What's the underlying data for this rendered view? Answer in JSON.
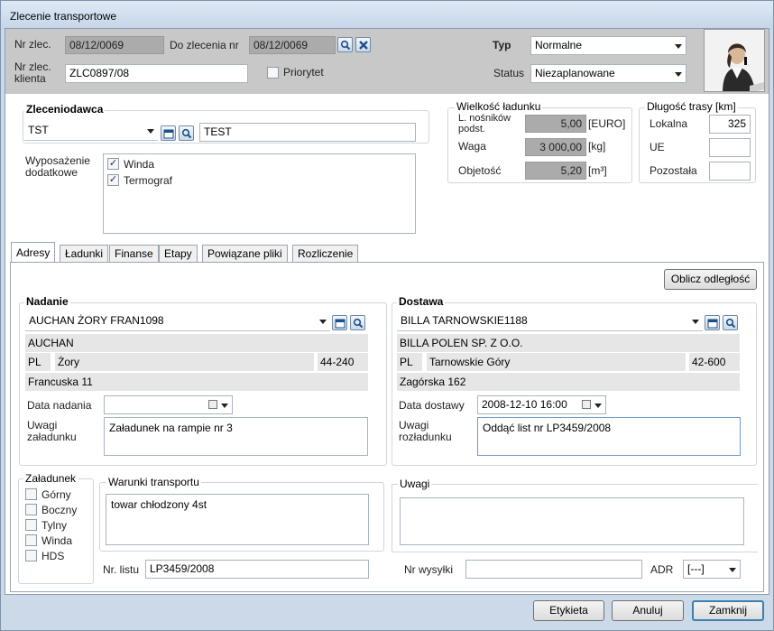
{
  "window": {
    "title": "Zlecenie transportowe"
  },
  "header": {
    "nr_zlec_label": "Nr zlec.",
    "nr_zlec_value": "08/12/0069",
    "do_zlecenia_label": "Do zlecenia nr",
    "do_zlecenia_value": "08/12/0069",
    "nr_zlec_klienta_label": "Nr zlec. klienta",
    "nr_zlec_klienta_value": "ZLC0897/08",
    "priorytet_label": "Priorytet",
    "priorytet_checked": false,
    "typ_label": "Typ",
    "typ_value": "Normalne",
    "status_label": "Status",
    "status_value": "Niezaplanowane"
  },
  "zleceniodawca": {
    "title": "Zleceniodawca",
    "code": "TST",
    "name": "TEST"
  },
  "wyposazenie": {
    "label": "Wyposażenie dodatkowe",
    "items": [
      {
        "label": "Winda",
        "checked": true
      },
      {
        "label": "Termograf",
        "checked": true
      }
    ]
  },
  "wielkosc": {
    "title": "Wielkość ładunku",
    "nosnikow_label": "L. nośników podst.",
    "nosnikow_value": "5,00",
    "nosnikow_unit": "[EURO]",
    "waga_label": "Waga",
    "waga_value": "3 000,00",
    "waga_unit": "[kg]",
    "objetosc_label": "Objetość",
    "objetosc_value": "5,20",
    "objetosc_unit": "[m³]"
  },
  "dlugosc": {
    "title": "Długość trasy [km]",
    "lokalna_label": "Lokalna",
    "lokalna_value": "325",
    "ue_label": "UE",
    "ue_value": "",
    "pozostala_label": "Pozostała",
    "pozostala_value": ""
  },
  "tabs": [
    {
      "label": "Adresy",
      "active": true
    },
    {
      "label": "Ładunki",
      "active": false
    },
    {
      "label": "Finanse",
      "active": false
    },
    {
      "label": "Etapy",
      "active": false
    },
    {
      "label": "Powiązane pliki",
      "active": false
    },
    {
      "label": "Rozliczenie",
      "active": false
    }
  ],
  "oblicz_label": "Oblicz odległość",
  "nadanie": {
    "title": "Nadanie",
    "select_value": "AUCHAN ŻORY FRAN1098",
    "company": "AUCHAN",
    "country": "PL",
    "city": "Żory",
    "postal": "44-240",
    "street": "Francuska 11",
    "date_label": "Data nadania",
    "date_value": "",
    "uwagi_label": "Uwagi załadunku",
    "uwagi_value": "Załadunek na rampie nr 3"
  },
  "dostawa": {
    "title": "Dostawa",
    "select_value": "BILLA TARNOWSKIE1188",
    "company": "BILLA POLEN SP. Z O.O.",
    "country": "PL",
    "city": "Tarnowskie Góry",
    "postal": "42-600",
    "street": "Zagórska 162",
    "date_label": "Data dostawy",
    "date_value": "2008-12-10 16:00",
    "uwagi_label": "Uwagi rozładunku",
    "uwagi_value": "Oddąć list nr LP3459/2008"
  },
  "zaladunek": {
    "title": "Załadunek",
    "items": [
      {
        "label": "Górny",
        "checked": false
      },
      {
        "label": "Boczny",
        "checked": false
      },
      {
        "label": "Tylny",
        "checked": false
      },
      {
        "label": "Winda",
        "checked": false
      },
      {
        "label": "HDS",
        "checked": false
      }
    ]
  },
  "warunki": {
    "title": "Warunki transportu",
    "value": "towar chłodzony 4st"
  },
  "uwagi": {
    "title": "Uwagi",
    "value": ""
  },
  "nr_listu": {
    "label": "Nr. listu",
    "value": "LP3459/2008"
  },
  "nr_wysylki": {
    "label": "Nr wysyłki",
    "value": ""
  },
  "adr": {
    "label": "ADR",
    "value": "[---]"
  },
  "footer": {
    "etykieta": "Etykieta",
    "anuluj": "Anuluj",
    "zamknij": "Zamknij"
  },
  "icons": {
    "search": "magnifier-icon",
    "clear": "x-icon",
    "calendar": "calendar-icon",
    "dropdown": "chevron-down-icon"
  },
  "colors": {
    "header_bg": "#c8c8c8",
    "readonly_bg": "#ababab",
    "window_frame": "#cbd9e8",
    "accent": "#3c7fb1"
  }
}
